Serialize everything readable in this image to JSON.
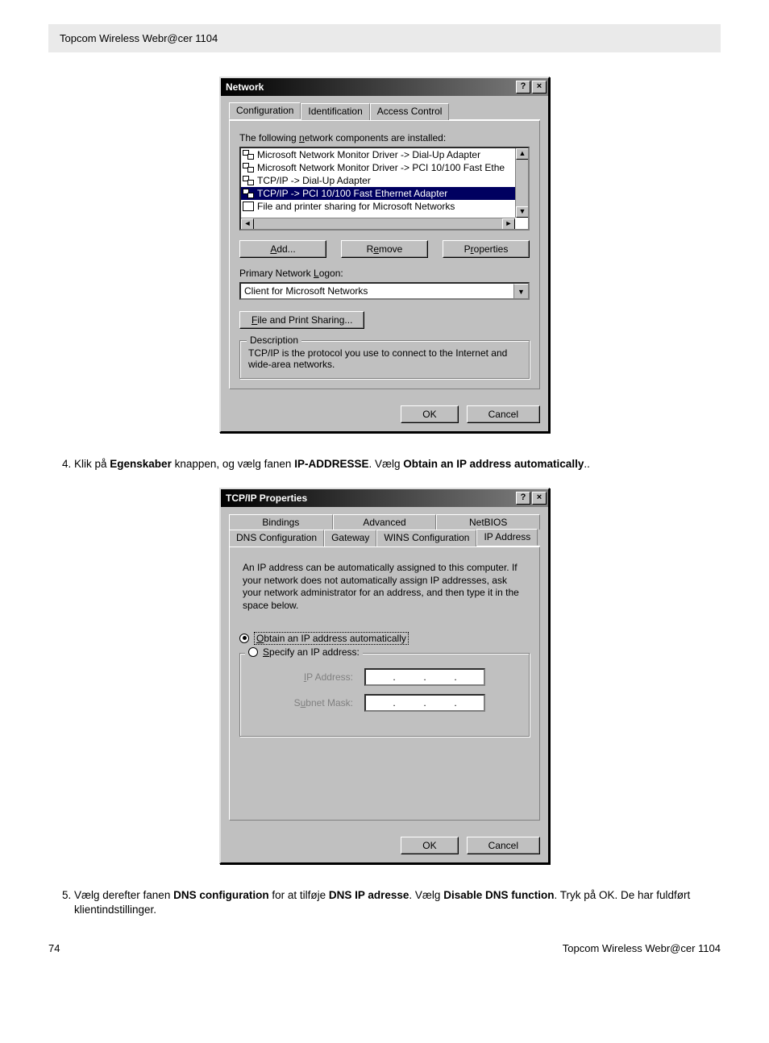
{
  "page": {
    "header_title": "Topcom Wireless Webr@cer 1104",
    "page_number": "74",
    "footer_right": "Topcom Wireless Webr@cer 1104"
  },
  "step4": {
    "number": "4.",
    "pre1": "Klik på ",
    "b1": "Egenskaber",
    "mid1": " knappen, og vælg fanen ",
    "b2": "IP-ADDRESSE",
    "mid2": ". Vælg ",
    "b3": "Obtain an IP address automatically",
    "tail": ".."
  },
  "step5": {
    "number": "5.",
    "pre1": "Vælg derefter fanen ",
    "b1": "DNS configuration",
    "mid1": " for at tilføje ",
    "b2": "DNS IP adresse",
    "mid2": ". Vælg ",
    "b3": "Disable DNS function",
    "tail": ". Tryk på OK. De har fuldført klientindstillinger."
  },
  "dlg1": {
    "title": "Network",
    "tabs": {
      "configuration": "Configuration",
      "identification": "Identification",
      "access": "Access Control"
    },
    "installed_label": "The following network components are installed:",
    "items": [
      "Microsoft Network Monitor Driver -> Dial-Up Adapter",
      "Microsoft Network Monitor Driver -> PCI 10/100 Fast Ethe",
      "TCP/IP -> Dial-Up Adapter",
      "TCP/IP -> PCI 10/100 Fast Ethernet Adapter",
      "File and printer sharing for Microsoft Networks"
    ],
    "buttons": {
      "add": "Add...",
      "remove": "Remove",
      "properties": "Properties"
    },
    "primary_logon_label": "Primary Network Logon:",
    "primary_logon_value": "Client for Microsoft Networks",
    "file_print": "File and Print Sharing...",
    "desc_legend": "Description",
    "desc_text": "TCP/IP is the protocol you use to connect to the Internet and wide-area networks.",
    "ok": "OK",
    "cancel": "Cancel"
  },
  "dlg2": {
    "title": "TCP/IP Properties",
    "tabs_row1": {
      "bindings": "Bindings",
      "advanced": "Advanced",
      "netbios": "NetBIOS"
    },
    "tabs_row2": {
      "dns": "DNS Configuration",
      "gateway": "Gateway",
      "wins": "WINS Configuration",
      "ip": "IP Address"
    },
    "blurb": "An IP address can be automatically assigned to this computer. If your network does not automatically assign IP addresses, ask your network administrator for an address, and then type it in the space below.",
    "radio_auto": "Obtain an IP address automatically",
    "radio_specify": "Specify an IP address:",
    "ip_label": "IP Address:",
    "mask_label": "Subnet Mask:",
    "ok": "OK",
    "cancel": "Cancel"
  }
}
